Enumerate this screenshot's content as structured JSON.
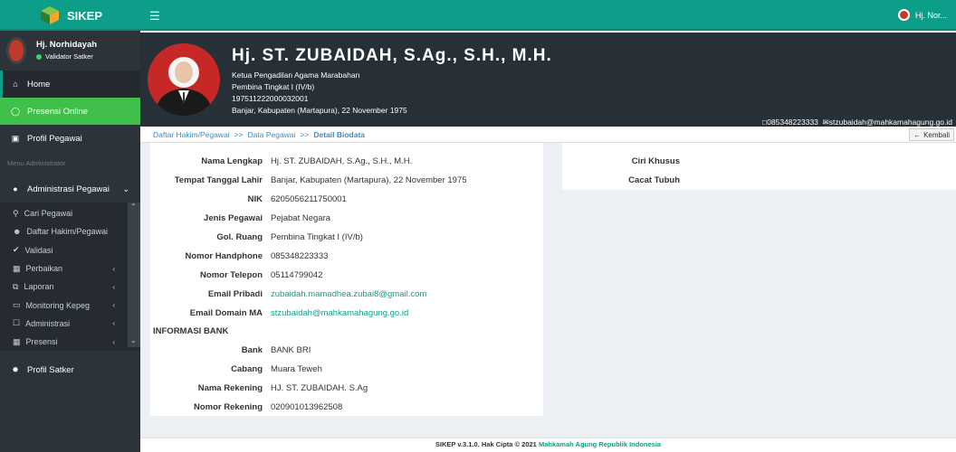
{
  "app": {
    "brand": "SIKEP",
    "top_user": "Hj. Nor..."
  },
  "sidebar": {
    "user_name": "Hj. Norhidayah",
    "user_status": "Validator Satker",
    "home": "Home",
    "presensi_online": "Presensi Online",
    "profil_pegawai": "Profil Pegawai",
    "menu_header": "Menu Administrator",
    "admin_pegawai": "Administrasi Pegawai",
    "submenu": [
      {
        "label": "Cari Pegawai",
        "icon": "search-icon"
      },
      {
        "label": "Daftar Hakim/Pegawai",
        "icon": "users-icon"
      },
      {
        "label": "Validasi",
        "icon": "check-icon"
      },
      {
        "label": "Perbaikan",
        "icon": "calendar-icon"
      },
      {
        "label": "Laporan",
        "icon": "copy-icon"
      },
      {
        "label": "Monitoring Kepeg",
        "icon": "monitor-icon"
      },
      {
        "label": "Administrasi",
        "icon": "square-icon"
      },
      {
        "label": "Presensi",
        "icon": "calendar-icon"
      }
    ],
    "profil_satker": "Profil Satker"
  },
  "profile": {
    "name": "Hj. ST. ZUBAIDAH, S.Ag., S.H., M.H.",
    "jabatan": "Ketua Pengadilan Agama Marabahan",
    "pangkat": "Pembina Tingkat I (IV/b)",
    "nip": "197511222000032001",
    "ttl": "Banjar, Kabupaten (Martapura), 22 November 1975",
    "phone": "085348223333",
    "email": "stzubaidah@mahkamahagung.go.id"
  },
  "breadcrumb": {
    "item1": "Daftar Hakim/Pegawai",
    "sep": ">>",
    "item2": "Data Pegawai",
    "current": "Detail Biodata",
    "back": "Kembali"
  },
  "biodata": [
    {
      "label": "Nama Lengkap",
      "value": "Hj. ST. ZUBAIDAH, S.Ag., S.H., M.H."
    },
    {
      "label": "Tempat Tanggal Lahir",
      "value": "Banjar, Kabupaten (Martapura), 22 November 1975"
    },
    {
      "label": "NIK",
      "value": "6205056211750001"
    },
    {
      "label": "Jenis Pegawai",
      "value": "Pejabat Negara"
    },
    {
      "label": "Gol. Ruang",
      "value": "Pembina Tingkat I (IV/b)"
    },
    {
      "label": "Nomor Handphone",
      "value": "085348223333"
    },
    {
      "label": "Nomor Telepon",
      "value": "05114799042"
    },
    {
      "label": "Email Pribadi",
      "value": "zubaidah.mamadhea.zubai8@gmail.com"
    },
    {
      "label": "Email Domain MA",
      "value": "stzubaidah@mahkamahagung.go.id"
    }
  ],
  "bank_section": "INFORMASI BANK",
  "bank": [
    {
      "label": "Bank",
      "value": "BANK BRI"
    },
    {
      "label": "Cabang",
      "value": "Muara Teweh"
    },
    {
      "label": "Nama Rekening",
      "value": "HJ. ST. ZUBAIDAH. S.Ag"
    },
    {
      "label": "Nomor Rekening",
      "value": "020901013962508"
    }
  ],
  "right_panel": {
    "ciri_khusus": "Ciri Khusus",
    "cacat_tubuh": "Cacat Tubuh"
  },
  "footer": {
    "text": "SIKEP v.3.1.0. Hak Cipta © 2021",
    "link": "Mahkamah Agung Republik Indonesia"
  },
  "colors": {
    "accent": "#0d9e8a",
    "sidebar": "#2c3339",
    "presensi": "#40c04a",
    "header": "#263036"
  }
}
